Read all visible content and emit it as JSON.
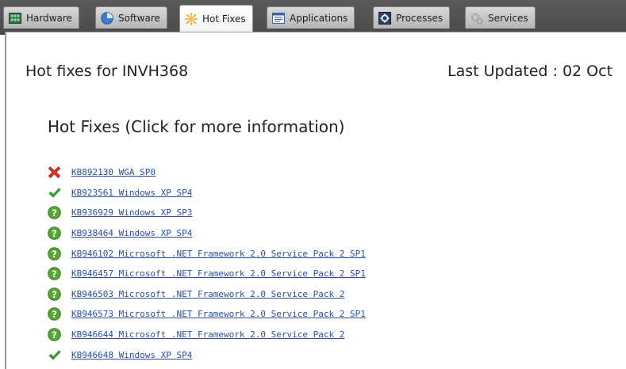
{
  "tabs": [
    {
      "label": "Hardware",
      "icon": "hardware-icon",
      "active": false
    },
    {
      "label": "Software",
      "icon": "software-icon",
      "active": false
    },
    {
      "label": "Hot Fixes",
      "icon": "hotfix-sun-icon",
      "active": true
    },
    {
      "label": "Applications",
      "icon": "applications-icon",
      "active": false
    },
    {
      "label": "Processes",
      "icon": "processes-icon",
      "active": false
    },
    {
      "label": "Services",
      "icon": "services-icon",
      "active": false
    }
  ],
  "page": {
    "title": "Hot fixes for INVH368",
    "last_updated": "Last Updated : 02 Oct",
    "section_title": "Hot Fixes (Click for more information)"
  },
  "hotfixes": [
    {
      "label": "KB892130 WGA SP0",
      "status": "failed",
      "icon": "red-x-icon"
    },
    {
      "label": "KB923561 Windows XP SP4",
      "status": "installed",
      "icon": "green-check-icon"
    },
    {
      "label": "KB936929 Windows XP SP3",
      "status": "question",
      "icon": "green-question-icon"
    },
    {
      "label": "KB938464 Windows XP SP4",
      "status": "question",
      "icon": "green-question-icon"
    },
    {
      "label": "KB946102 Microsoft .NET Framework 2.0 Service Pack 2 SP1",
      "status": "question",
      "icon": "green-question-icon"
    },
    {
      "label": "KB946457 Microsoft .NET Framework 2.0 Service Pack 2 SP1",
      "status": "question",
      "icon": "green-question-icon"
    },
    {
      "label": "KB946503 Microsoft .NET Framework 2.0 Service Pack 2",
      "status": "question",
      "icon": "green-question-icon"
    },
    {
      "label": "KB946573 Microsoft .NET Framework 2.0 Service Pack 2 SP1",
      "status": "question",
      "icon": "green-question-icon"
    },
    {
      "label": "KB946644 Microsoft .NET Framework 2.0 Service Pack 2",
      "status": "question",
      "icon": "green-question-icon"
    },
    {
      "label": "KB946648 Windows XP SP4",
      "status": "installed",
      "icon": "green-check-icon"
    }
  ],
  "colors": {
    "link": "#2a4f9e",
    "failed": "#d9352a",
    "installed": "#3c9a2c",
    "question": "#56a832",
    "tabbar": "#555555"
  }
}
